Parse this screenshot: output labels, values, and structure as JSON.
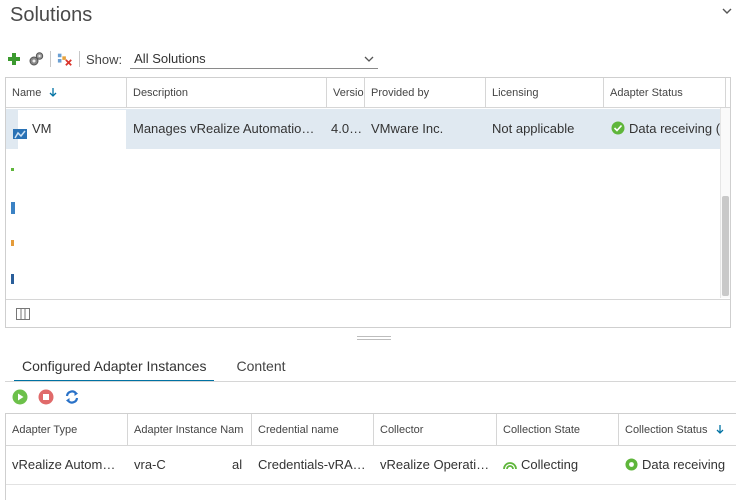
{
  "page": {
    "title": "Solutions"
  },
  "toolbar": {
    "show_label": "Show:",
    "show_value": "All Solutions"
  },
  "grid": {
    "columns": [
      "Name",
      "Description",
      "Versio",
      "Provided by",
      "Licensing",
      "Adapter Status"
    ],
    "row": {
      "name": "VM",
      "description": "Manages vRealize Automatio…",
      "version": "4.0…",
      "provided_by": "VMware Inc.",
      "licensing": "Not applicable",
      "adapter_status": "Data receiving ("
    }
  },
  "tabs": [
    {
      "label": "Configured Adapter Instances"
    },
    {
      "label": "Content"
    }
  ],
  "instances": {
    "columns": [
      "Adapter Type",
      "Adapter Instance Nam",
      "Credential name",
      "Collector",
      "Collection State",
      "Collection Status"
    ],
    "row": {
      "adapter_type": "vRealize Autom…",
      "instance_name": "vra-C",
      "instance_suffix": "al",
      "credential": "Credentials-vRA…",
      "collector": "vRealize Operati…",
      "collection_state": "Collecting",
      "collection_status": "Data receiving"
    }
  },
  "colors": {
    "accent": "#0072a3",
    "selected_row": "#e0e9f1",
    "status_ok": "#5fb63b",
    "add_green": "#3c9a2f",
    "stop_red": "#e06a6a"
  }
}
